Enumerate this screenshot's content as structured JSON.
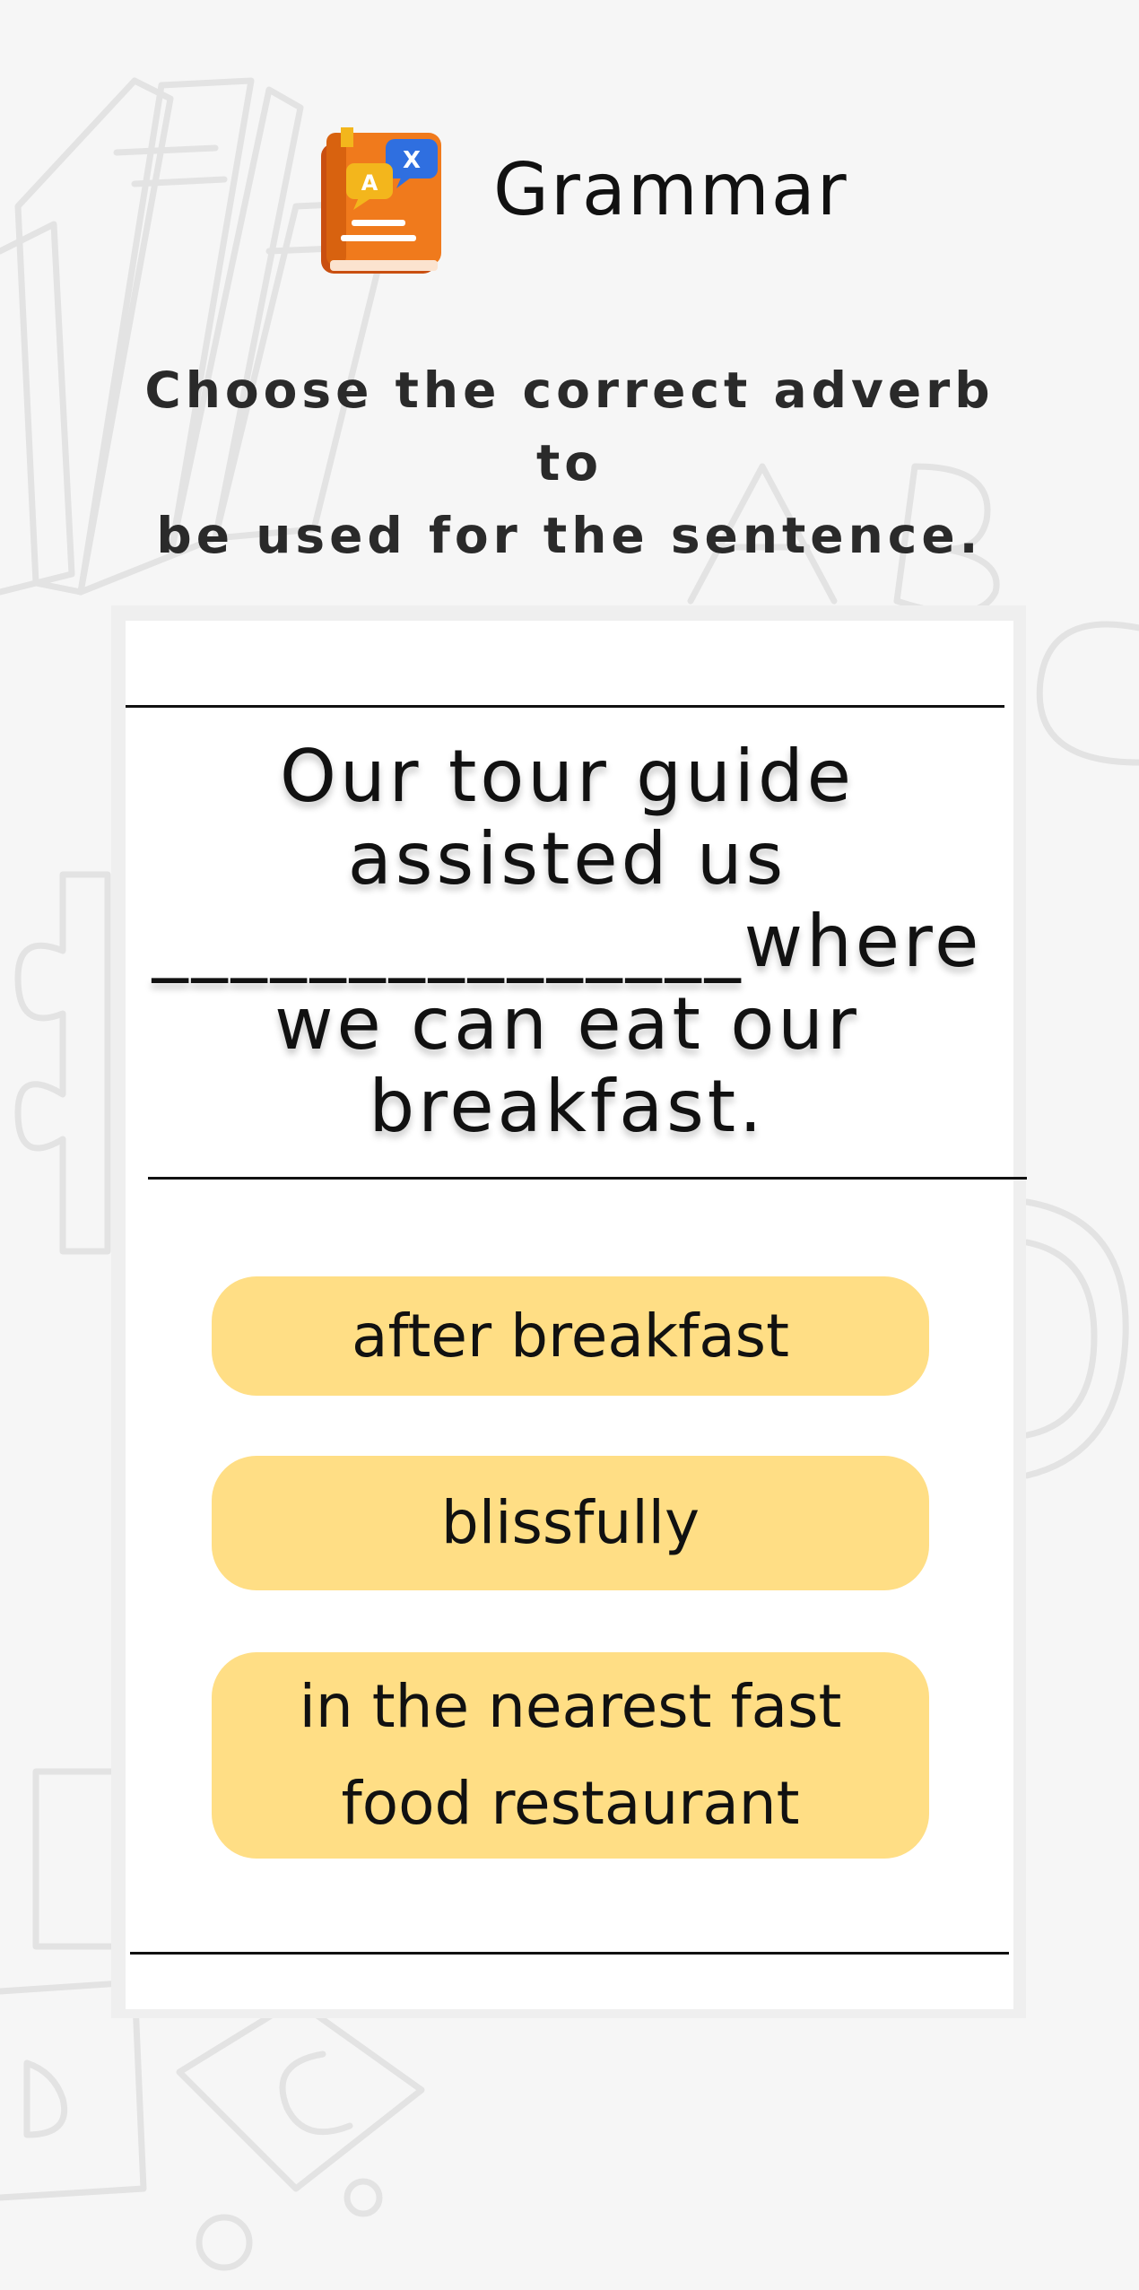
{
  "header": {
    "icon": "grammar-book-icon",
    "title": "Grammar"
  },
  "instruction": {
    "line1": "Choose the correct adverb to",
    "line2": "be used for the sentence."
  },
  "question": {
    "sentence": "Our tour guide assisted us _______________where we can eat our breakfast."
  },
  "options": [
    {
      "label": "after breakfast"
    },
    {
      "label": "blissfully"
    },
    {
      "label": "in the nearest fast food restaurant"
    }
  ],
  "colors": {
    "background": "#f6f6f6",
    "card": "#ffffff",
    "option_fill": "#ffde85",
    "doodle_stroke": "#e3e3e3",
    "icon_book": "#f07a1c",
    "icon_bubble": "#2f6fe0",
    "icon_bubble_alt": "#f3b61c"
  }
}
